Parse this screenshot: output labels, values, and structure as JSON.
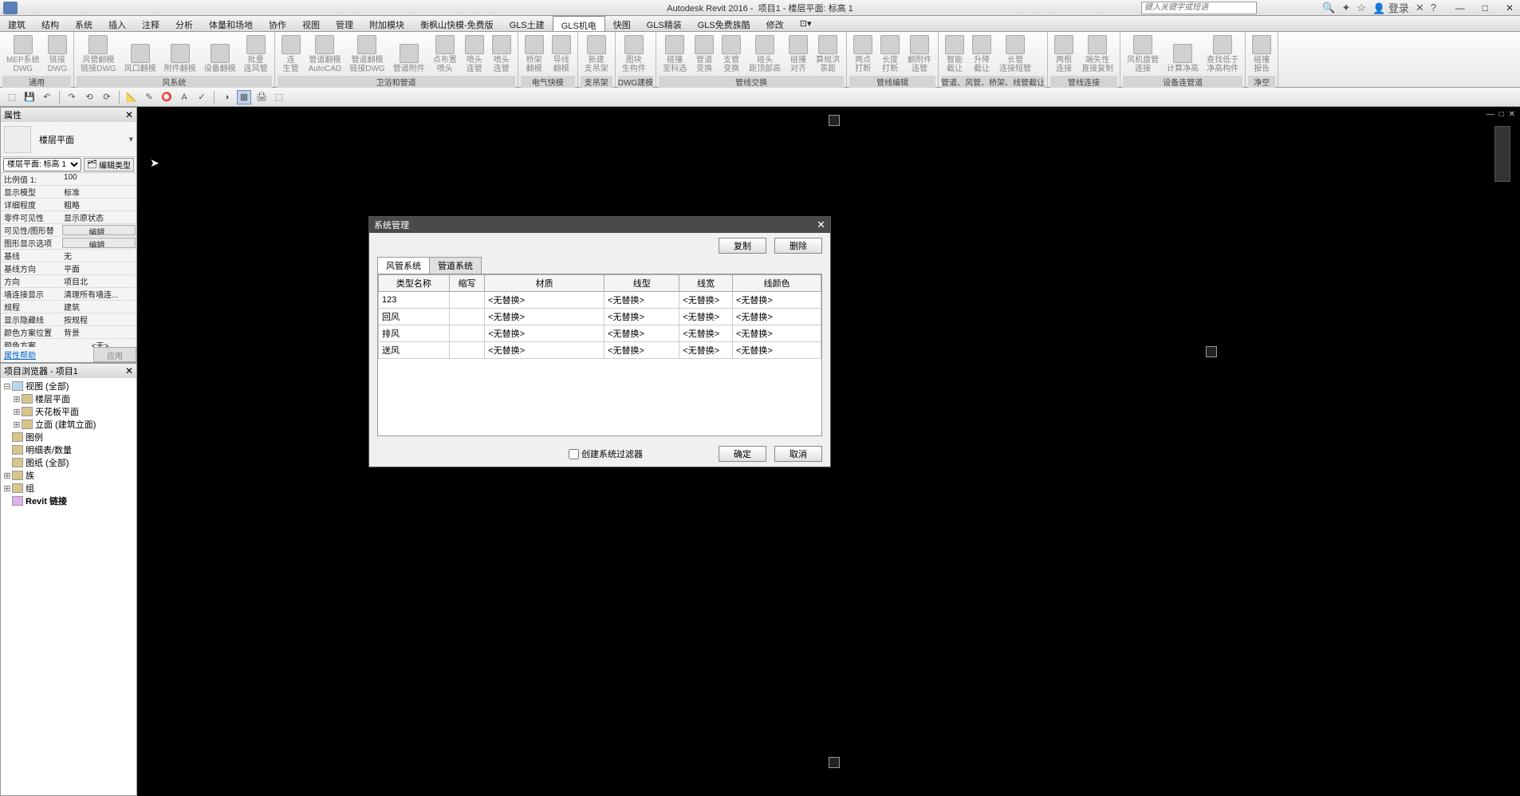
{
  "titlebar": {
    "app": "Autodesk Revit 2016 -",
    "doc": "项目1 - 楼层平面: 标高 1",
    "search_placeholder": "键入关键字或短语",
    "login": "登录"
  },
  "menu": [
    "建筑",
    "结构",
    "系统",
    "插入",
    "注释",
    "分析",
    "体量和场地",
    "协作",
    "视图",
    "管理",
    "附加模块",
    "衡枫山快模-免费版",
    "GLS土建",
    "GLS机电",
    "快图",
    "GLS精装",
    "GLS免费族酷",
    "修改"
  ],
  "menu_active": "GLS机电",
  "ribbon_groups": [
    {
      "label": "通用",
      "items": [
        "MEP系统\nDWG",
        "链接\nDWG"
      ]
    },
    {
      "label": "风系统",
      "items": [
        "风管翻模\n链接DWG",
        "风口翻模",
        "附件翻模",
        "设备翻模",
        "批量\n连风管"
      ]
    },
    {
      "label": "卫浴和管道",
      "items": [
        "连\n生管",
        "管道翻模\nAutoCAD",
        "管道翻模\n链接DWG",
        "管道附件",
        "点布置\n喷头",
        "喷头\n连管",
        "喷头\n连管"
      ]
    },
    {
      "label": "电气快模",
      "items": [
        "桥架\n翻模",
        "导线\n翻模"
      ]
    },
    {
      "label": "支吊架",
      "items": [
        "新建\n支吊架"
      ]
    },
    {
      "label": "DWG建模",
      "items": [
        "图块\n生构件"
      ]
    },
    {
      "label": "管线交换",
      "items": [
        "碰撞\n至科选",
        "管道\n变换",
        "支管\n变换",
        "碰头\n距顶部高",
        "碰撞\n对齐",
        "算规洪\n茶距"
      ]
    },
    {
      "label": "管线编辑",
      "items": [
        "两点\n打断",
        "长度\n打断",
        "翻附件\n连管"
      ]
    },
    {
      "label": "管道、风管、桥架、线管截让",
      "items": [
        "智能\n截让",
        "升降\n截让",
        "长管\n连接短管"
      ]
    },
    {
      "label": "管线连接",
      "items": [
        "两根\n连接",
        "端失性\n直接复制"
      ]
    },
    {
      "label": "设备连管道",
      "items": [
        "风机盘管\n连接",
        "计算净高",
        "查找低于\n净高构件"
      ]
    },
    {
      "label": "净空",
      "items": [
        "碰撞\n报告"
      ]
    }
  ],
  "quickbar_icons": [
    "⬚",
    "💾",
    "↶",
    "↷",
    "⟲",
    "⟳",
    "📐",
    "✎",
    "⭕",
    "A",
    "✓",
    "◑",
    "▦",
    "🖨",
    "⬚"
  ],
  "properties": {
    "title": "属性",
    "type": "楼层平面",
    "instance": "楼层平面: 标高 1",
    "edit_type": "编辑类型",
    "rows": [
      {
        "k": "比例值 1:",
        "v": "100"
      },
      {
        "k": "显示模型",
        "v": "标准"
      },
      {
        "k": "详细程度",
        "v": "粗略"
      },
      {
        "k": "零件可见性",
        "v": "显示原状态"
      },
      {
        "k": "可见性/图形替换",
        "v": "编辑...",
        "btn": true
      },
      {
        "k": "图形显示选项",
        "v": "编辑...",
        "btn": true
      },
      {
        "k": "基线",
        "v": "无"
      },
      {
        "k": "基线方向",
        "v": "平面"
      },
      {
        "k": "方向",
        "v": "项目北"
      },
      {
        "k": "墙连接显示",
        "v": "清理所有墙连..."
      },
      {
        "k": "规程",
        "v": "建筑"
      },
      {
        "k": "显示隐藏线",
        "v": "按规程"
      },
      {
        "k": "颜色方案位置",
        "v": "背景"
      },
      {
        "k": "颜色方案",
        "v": "<无>",
        "dd": true
      }
    ],
    "help": "属性帮助",
    "apply": "应用"
  },
  "browser": {
    "title": "项目浏览器 - 项目1",
    "nodes": [
      {
        "d": 0,
        "exp": "⊟",
        "ico": "view",
        "label": "视图 (全部)"
      },
      {
        "d": 1,
        "exp": "⊞",
        "ico": "",
        "label": "楼层平面"
      },
      {
        "d": 1,
        "exp": "⊞",
        "ico": "",
        "label": "天花板平面"
      },
      {
        "d": 1,
        "exp": "⊞",
        "ico": "",
        "label": "立面 (建筑立面)"
      },
      {
        "d": 0,
        "exp": "",
        "ico": "sheet",
        "label": "图例"
      },
      {
        "d": 0,
        "exp": "",
        "ico": "sheet",
        "label": "明细表/数量"
      },
      {
        "d": 0,
        "exp": "",
        "ico": "sheet",
        "label": "图纸 (全部)"
      },
      {
        "d": 0,
        "exp": "⊞",
        "ico": "fam",
        "label": "族"
      },
      {
        "d": 0,
        "exp": "⊞",
        "ico": "fam",
        "label": "组"
      },
      {
        "d": 0,
        "exp": "",
        "ico": "link",
        "label": "Revit 链接",
        "bold": true
      }
    ]
  },
  "dialog": {
    "title": "系统管理",
    "copy": "复制",
    "delete": "删除",
    "tabs": [
      "风管系统",
      "管道系统"
    ],
    "active_tab": 0,
    "columns": [
      "类型名称",
      "缩写",
      "材质",
      "线型",
      "线宽",
      "线颜色"
    ],
    "rows": [
      [
        "123",
        "",
        "<无替换>",
        "<无替换>",
        "<无替换>",
        "<无替换>"
      ],
      [
        "回风",
        "",
        "<无替换>",
        "<无替换>",
        "<无替换>",
        "<无替换>"
      ],
      [
        "排风",
        "",
        "<无替换>",
        "<无替换>",
        "<无替换>",
        "<无替换>"
      ],
      [
        "送风",
        "",
        "<无替换>",
        "<无替换>",
        "<无替换>",
        "<无替换>"
      ]
    ],
    "checkbox": "创建系统过滤器",
    "ok": "确定",
    "cancel": "取消"
  }
}
